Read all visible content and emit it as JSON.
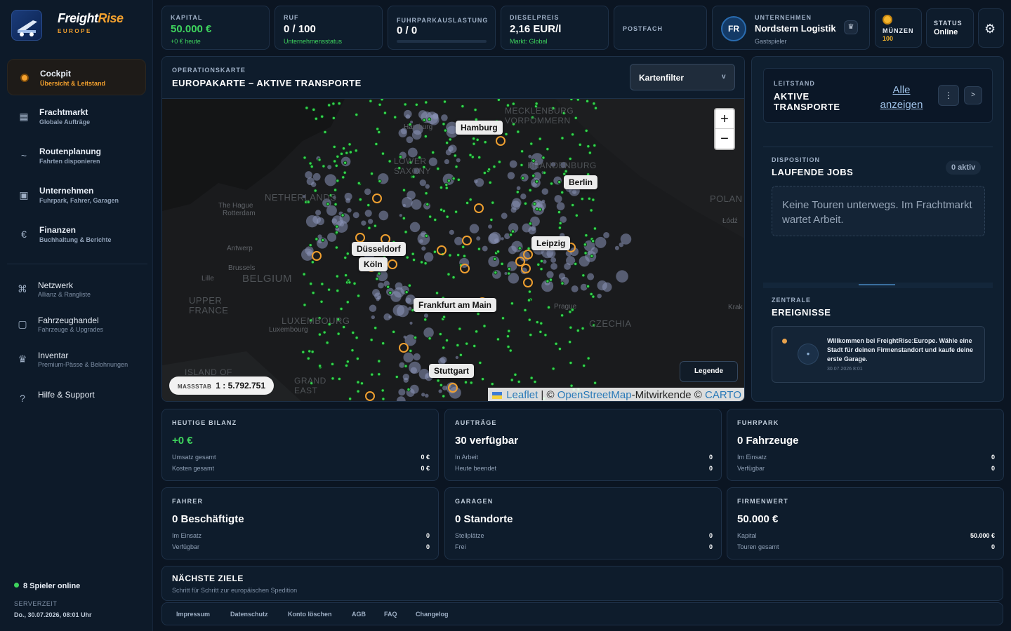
{
  "brand": {
    "name_a": "Freight",
    "name_b": "Rise",
    "sub": "EUROPE"
  },
  "nav": [
    {
      "label": "Cockpit",
      "sub": "Übersicht & Leitstand",
      "icon": "●"
    },
    {
      "label": "Frachtmarkt",
      "sub": "Globale Aufträge",
      "icon": "▦"
    },
    {
      "label": "Routenplanung",
      "sub": "Fahrten disponieren",
      "icon": "~"
    },
    {
      "label": "Unternehmen",
      "sub": "Fuhrpark, Fahrer, Garagen",
      "icon": "▣"
    },
    {
      "label": "Finanzen",
      "sub": "Buchhaltung & Berichte",
      "icon": "€"
    }
  ],
  "nav2": [
    {
      "label": "Netzwerk",
      "sub": "Allianz & Rangliste",
      "icon": "⌘"
    },
    {
      "label": "Fahrzeughandel",
      "sub": "Fahrzeuge & Upgrades",
      "icon": "▢"
    },
    {
      "label": "Inventar",
      "sub": "Premium-Pässe & Belohnungen",
      "icon": "♛"
    },
    {
      "label": "Hilfe & Support",
      "sub": "",
      "icon": "?"
    }
  ],
  "sidebar_footer": {
    "online": "8 Spieler online",
    "server_label": "SERVERZEIT",
    "server_time": "Do., 30.07.2026, 08:01 Uhr"
  },
  "top": {
    "kapital": {
      "label": "KAPITAL",
      "value": "50.000 €",
      "sub": "+0 € heute"
    },
    "ruf": {
      "label": "RUF",
      "value": "0 / 100",
      "sub": "Unternehmensstatus"
    },
    "fuhrpark": {
      "label": "FUHRPARKAUSLASTUNG",
      "value": "0 / 0",
      "progress": 0
    },
    "diesel": {
      "label": "DIESELPREIS",
      "value": "2,16 EUR/l",
      "sub": "Markt: Global"
    },
    "postfach": {
      "label": "POSTFACH"
    },
    "company": {
      "avatar": "FR",
      "label": "UNTERNEHMEN",
      "name": "Nordstern Logistik",
      "sub": "Gastspieler"
    },
    "coins": {
      "label": "MÜNZEN",
      "value": "100"
    },
    "status": {
      "label": "STATUS",
      "value": "Online"
    }
  },
  "map": {
    "eyebrow": "OPERATIONSKARTE",
    "title": "EUROPAKARTE – AKTIVE TRANSPORTE",
    "filter": "Kartenfilter",
    "cities": [
      "Hamburg",
      "Berlin",
      "Düsseldorf",
      "Köln",
      "Leipzig",
      "Frankfurt am Main",
      "Stuttgart"
    ],
    "regions": [
      "NETHERLANDS",
      "BELGIUM",
      "LUXEMBOURG",
      "UPPER FRANCE",
      "GRAND EAST",
      "POLAN",
      "CZECHIA",
      "BRANDENBURG",
      "MECKLENBURG VORPOMMERN",
      "LOWER SAXONY",
      "ISLAND OF"
    ],
    "minor": [
      "The Hague",
      "Rotterdam",
      "Antwerp",
      "Brussels",
      "Lille",
      "Luxembourg",
      "Prague",
      "Łódź",
      "Krak",
      "Hamburg"
    ],
    "zoom_in": "+",
    "zoom_out": "−",
    "scale_label": "MASSSTAB",
    "scale_value": "1 : 5.792.751",
    "legend": "Legende",
    "attribution": {
      "leaflet": "Leaflet",
      "sep": " | © ",
      "osm": "OpenStreetMap",
      "mid": "-Mitwirkende © ",
      "carto": "CARTO"
    }
  },
  "right": {
    "leitstand": {
      "eyebrow": "LEITSTAND",
      "title1": "AKTIVE",
      "title2": "TRANSPORTE",
      "link1": "Alle",
      "link2": "anzeigen",
      "btn_more": "⋮",
      "btn_next": ">"
    },
    "dispo": {
      "eyebrow": "DISPOSITION",
      "title": "LAUFENDE JOBS",
      "count": "0 aktiv",
      "empty": "Keine Touren unterwegs. Im Frachtmarkt wartet Arbeit."
    },
    "events": {
      "eyebrow": "ZENTRALE",
      "title": "EREIGNISSE",
      "text": "Willkommen bei FreightRise:Europe. Wähle eine Stadt für deinen Firmenstandort und kaufe deine erste Garage.",
      "time": "30.07.2026 8:01"
    }
  },
  "stats": [
    {
      "label": "HEUTIGE BILANZ",
      "value": "+0 €",
      "green": true,
      "rows": [
        [
          "Umsatz gesamt",
          "0 €"
        ],
        [
          "Kosten gesamt",
          "0 €"
        ]
      ]
    },
    {
      "label": "AUFTRÄGE",
      "value": "30 verfügbar",
      "rows": [
        [
          "In Arbeit",
          "0"
        ],
        [
          "Heute beendet",
          "0"
        ]
      ]
    },
    {
      "label": "FUHRPARK",
      "value": "0 Fahrzeuge",
      "rows": [
        [
          "Im Einsatz",
          "0"
        ],
        [
          "Verfügbar",
          "0"
        ]
      ]
    },
    {
      "label": "FAHRER",
      "value": "0 Beschäftigte",
      "rows": [
        [
          "Im Einsatz",
          "0"
        ],
        [
          "Verfügbar",
          "0"
        ]
      ]
    },
    {
      "label": "GARAGEN",
      "value": "0 Standorte",
      "rows": [
        [
          "Stellplätze",
          "0"
        ],
        [
          "Frei",
          "0"
        ]
      ]
    },
    {
      "label": "FIRMENWERT",
      "value": "50.000 €",
      "rows": [
        [
          "Kapital",
          "50.000 €"
        ],
        [
          "Touren gesamt",
          "0"
        ]
      ]
    }
  ],
  "goals": {
    "title": "NÄCHSTE ZIELE",
    "sub": "Schritt für Schritt zur europäischen Spedition"
  },
  "footer": [
    "Impressum",
    "Datenschutz",
    "Konto löschen",
    "AGB",
    "FAQ",
    "Changelog"
  ],
  "colors": {
    "accent": "#f4a12e",
    "green": "#3ed35d",
    "bg": "#0b1522"
  }
}
